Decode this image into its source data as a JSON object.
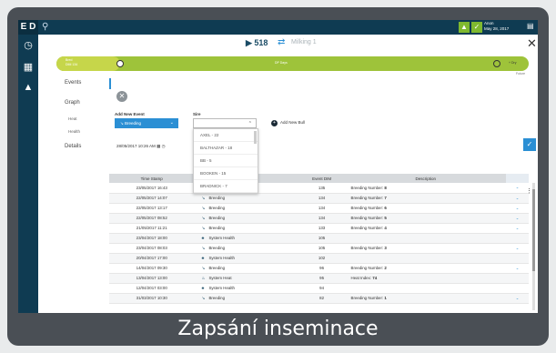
{
  "caption": "Zapsání inseminace",
  "rail": {
    "logo": "E D",
    "icons": [
      "clock-icon",
      "barn-icon",
      "home-icon"
    ]
  },
  "topbar": {
    "search_icon": "search-icon",
    "user_line1": "Anon",
    "user_line2": "May 28, 2017"
  },
  "header": {
    "cow_number": "518",
    "swap_icon": "swap-icon",
    "milking_label": "Milking 1"
  },
  "timeline": {
    "left_label_1": "Bred",
    "left_label_2": "DIM 134",
    "mid_label": "DP Days",
    "end_label": "+ Dry",
    "future_label": "Future"
  },
  "nav": {
    "events": "Events",
    "graph": "Graph",
    "heat": "Heat",
    "health": "Health",
    "details": "Details"
  },
  "form": {
    "add_new_event_label": "Add New Event",
    "event_value": "Breeding",
    "sire_label": "Sire",
    "add_bull": "Add New Bull",
    "datetime": "28/05/2017 10:26 AM"
  },
  "sire_options": [
    "AXEL - 22",
    "BALTHAZAR - 18",
    "BB - 5",
    "BOOKEN - 15",
    "BRADNICK - 7"
  ],
  "table": {
    "headers": {
      "timestamp": "Time Stamp",
      "dim": "Event DIM",
      "description": "Description"
    },
    "rows": [
      {
        "ts": "23/05/2017 16:43",
        "type": "Breeding",
        "dim": "135",
        "desc": "Breeding Number:",
        "num": "8",
        "expand": true
      },
      {
        "ts": "22/05/2017 14:07",
        "type": "Breeding",
        "dim": "134",
        "desc": "Breeding Number:",
        "num": "7",
        "expand": true
      },
      {
        "ts": "22/05/2017 13:17",
        "type": "Breeding",
        "dim": "134",
        "desc": "Breeding Number:",
        "num": "6",
        "expand": true
      },
      {
        "ts": "22/05/2017 08:52",
        "type": "Breeding",
        "dim": "134",
        "desc": "Breeding Number:",
        "num": "5",
        "expand": true
      },
      {
        "ts": "21/05/2017 11:21",
        "type": "Breeding",
        "dim": "133",
        "desc": "Breeding Number:",
        "num": "4",
        "expand": true
      },
      {
        "ts": "23/04/2017 18:00",
        "type": "System Health",
        "dim": "105",
        "desc": "",
        "num": "",
        "expand": false
      },
      {
        "ts": "23/04/2017 08:03",
        "type": "Breeding",
        "dim": "105",
        "desc": "Breeding Number:",
        "num": "3",
        "expand": true
      },
      {
        "ts": "20/04/2017 17:00",
        "type": "System Health",
        "dim": "102",
        "desc": "",
        "num": "",
        "expand": false
      },
      {
        "ts": "14/04/2017 09:30",
        "type": "Breeding",
        "dim": "96",
        "desc": "Breeding Number:",
        "num": "2",
        "expand": true
      },
      {
        "ts": "13/04/2017 13:00",
        "type": "System Heat",
        "dim": "95",
        "desc": "Heat Index:",
        "num": "74",
        "expand": false
      },
      {
        "ts": "12/04/2017 03:00",
        "type": "System Health",
        "dim": "94",
        "desc": "",
        "num": "",
        "expand": false
      },
      {
        "ts": "31/03/2017 10:30",
        "type": "Breeding",
        "dim": "82",
        "desc": "Breeding Number:",
        "num": "1",
        "expand": true
      }
    ]
  },
  "colors": {
    "accent": "#2b8fd4",
    "rail": "#0f3b52",
    "timeline": "#9ec33a"
  }
}
